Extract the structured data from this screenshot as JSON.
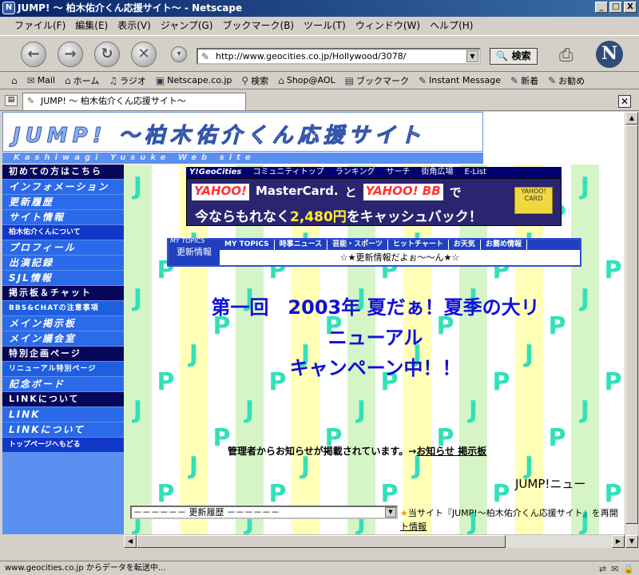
{
  "window": {
    "title": "JUMP! 〜 柏木佑介くん応援サイト〜 - Netscape",
    "app_icon": "N"
  },
  "window_controls": {
    "minimize": "_",
    "maximize": "□",
    "close": "X"
  },
  "menu": [
    "ファイル(F)",
    "編集(E)",
    "表示(V)",
    "ジャンプ(G)",
    "ブックマーク(B)",
    "ツール(T)",
    "ウィンドウ(W)",
    "ヘルプ(H)"
  ],
  "nav": {
    "url": "http://www.geocities.co.jp/Hollywood/3078/",
    "search_label": "検索",
    "logo": "N"
  },
  "bookmarks": [
    "Mail",
    "ホーム",
    "ラジオ",
    "Netscape.co.jp",
    "検索",
    "Shop@AOL",
    "ブックマーク",
    "Instant Message",
    "新着",
    "お勧め"
  ],
  "tab": {
    "title": "JUMP! 〜 柏木佑介くん応援サイト〜"
  },
  "header": {
    "title": "JUMP! 〜柏木佑介くん応援サイト",
    "subtitle": "Kashiwagi Yusuke Web site"
  },
  "sidebar": [
    {
      "label": "初めての方はこちら",
      "style": "dark"
    },
    {
      "label": "インフォメーション",
      "style": "light"
    },
    {
      "label": "更新履歴",
      "style": "light"
    },
    {
      "label": "サイト情報",
      "style": "light"
    },
    {
      "label": "柏木佑介くんについて",
      "style": "tiny"
    },
    {
      "label": "プロフィール",
      "style": "light"
    },
    {
      "label": "出演記録",
      "style": "light"
    },
    {
      "label": "SJL情報",
      "style": "light"
    },
    {
      "label": "掲示板＆チャット",
      "style": "dark"
    },
    {
      "label": "BBS&CHATの注意事項",
      "style": "small"
    },
    {
      "label": "メイン掲示板",
      "style": "light"
    },
    {
      "label": "メイン議会室",
      "style": "light"
    },
    {
      "label": "特別企画ページ",
      "style": "dark"
    },
    {
      "label": "リニューアル特別ページ",
      "style": "small"
    },
    {
      "label": "記念ボード",
      "style": "light"
    },
    {
      "label": "LINKについて",
      "style": "dark"
    },
    {
      "label": "LINK",
      "style": "light"
    },
    {
      "label": "LINKについて",
      "style": "light"
    },
    {
      "label": "トップページへもどる",
      "style": "tiny"
    }
  ],
  "geocities": {
    "logo": "Y!GeoCities",
    "links": [
      "コミュニティトップ",
      "ランキング",
      "サーチ",
      "街角広場",
      "E-List"
    ]
  },
  "ad": {
    "line1": [
      "YAHOO!",
      "MasterCard.",
      "と",
      "YAHOO! BB",
      "で"
    ],
    "line2_prefix": "今ならもれなく",
    "line2_price": "2,480円",
    "line2_suffix": "をキャッシュバック！",
    "card_label": "YAHOO! CARD"
  },
  "topics": {
    "label": "更新情報",
    "label_small": "MY TOPICS",
    "tabs": [
      "MY TOPICS",
      "時事ニュース",
      "芸能・スポーツ",
      "ヒットチャート",
      "お天気",
      "お薦め情報"
    ],
    "news": "☆★更新情報だよぉ〜〜ん★☆"
  },
  "campaign": {
    "lines": [
      "第一回　2003年 夏だぁ！夏季の大リ",
      "ニューアル",
      "キャンペーン中！！"
    ]
  },
  "notice": {
    "text": "管理者からお知らせが掲載されています。→",
    "link": "お知らせ 掲示板"
  },
  "news_heading": "JUMP!ニュー",
  "history_select": {
    "value": "－－－－－－ 更新履歴 －－－－－－"
  },
  "info": {
    "star": "★",
    "text": "当サイト『JUMP!〜柏木佑介くん応援サイト』を再開",
    "link": "ト情報"
  },
  "status": {
    "text": "www.geocities.co.jp からデータを転送中..."
  },
  "colors": {
    "accent": "#1010d8",
    "sidebar": "#5b8ff0",
    "checker_text": "#33e0b8"
  }
}
